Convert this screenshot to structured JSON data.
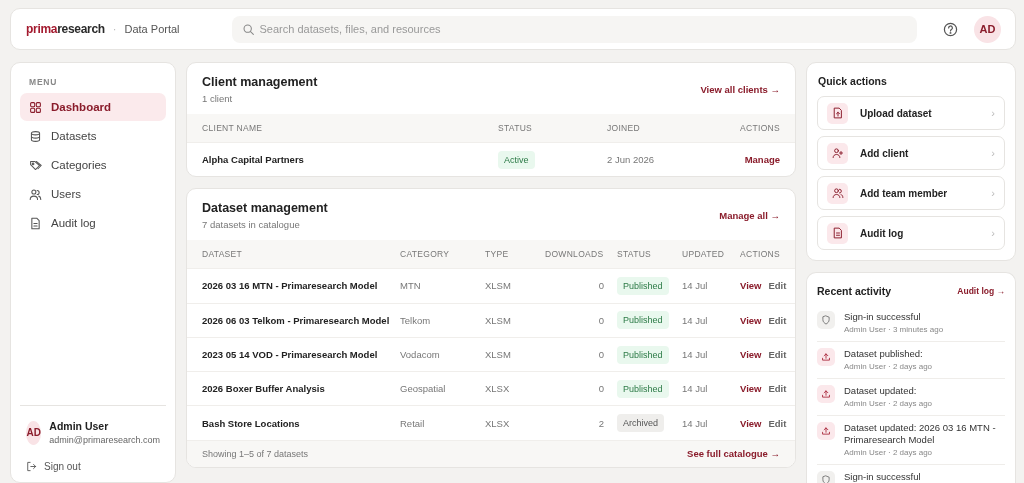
{
  "topbar": {
    "logo": {
      "accent": "prima",
      "rest": "research"
    },
    "separator": "·",
    "portal": "Data Portal",
    "search": {
      "placeholder": "Search datasets, files, and resources"
    },
    "avatar": "AD"
  },
  "sidebar": {
    "heading": "MENU",
    "items": [
      {
        "label": "Dashboard",
        "selected": true
      },
      {
        "label": "Datasets",
        "selected": false
      },
      {
        "label": "Categories",
        "selected": false
      },
      {
        "label": "Users",
        "selected": false
      },
      {
        "label": "Audit log",
        "selected": false
      }
    ],
    "user": {
      "initials": "AD",
      "name": "Admin User",
      "email": "admin@primaresearch.com"
    },
    "sign_out": "Sign out"
  },
  "client_management": {
    "title": "Client management",
    "subtitle": "1 client",
    "link": "View all clients →",
    "columns": [
      "CLIENT NAME",
      "STATUS",
      "JOINED",
      "ACTIONS"
    ],
    "rows": [
      {
        "name": "Alpha Capital Partners",
        "status": {
          "label": "Active",
          "kind": "positive"
        },
        "joined": "2 Jun 2026",
        "action": "Manage"
      }
    ]
  },
  "dataset_management": {
    "title": "Dataset management",
    "subtitle": "7 datasets in catalogue",
    "link": "Manage all →",
    "columns": [
      "DATASET",
      "CATEGORY",
      "TYPE",
      "DOWNLOADS",
      "STATUS",
      "UPDATED",
      "ACTIONS"
    ],
    "rows": [
      {
        "name": "2026 03 16 MTN - Primaresearch Model",
        "category": "MTN",
        "type": "XLSM",
        "downloads": "0",
        "status": {
          "label": "Published",
          "kind": "positive"
        },
        "updated": "14 Jul",
        "actions": [
          "View",
          "Edit"
        ]
      },
      {
        "name": "2026 06 03 Telkom - Primaresearch Model",
        "category": "Telkom",
        "type": "XLSM",
        "downloads": "0",
        "status": {
          "label": "Published",
          "kind": "positive"
        },
        "updated": "14 Jul",
        "actions": [
          "View",
          "Edit"
        ]
      },
      {
        "name": "2023 05 14 VOD - Primaresearch Model",
        "category": "Vodacom",
        "type": "XLSM",
        "downloads": "0",
        "status": {
          "label": "Published",
          "kind": "positive"
        },
        "updated": "14 Jul",
        "actions": [
          "View",
          "Edit"
        ]
      },
      {
        "name": "2026 Boxer Buffer Analysis",
        "category": "Geospatial",
        "type": "XLSX",
        "downloads": "0",
        "status": {
          "label": "Published",
          "kind": "positive"
        },
        "updated": "14 Jul",
        "actions": [
          "View",
          "Edit"
        ]
      },
      {
        "name": "Bash Store Locations",
        "category": "Retail",
        "type": "XLSX",
        "downloads": "2",
        "status": {
          "label": "Archived",
          "kind": "neutral"
        },
        "updated": "14 Jul",
        "actions": [
          "View",
          "Edit"
        ]
      }
    ],
    "footer": "Showing 1–5 of 7 datasets",
    "footer_link": "See full catalogue →"
  },
  "quick_actions": {
    "title": "Quick actions",
    "items": [
      {
        "label": "Upload dataset",
        "chevron": "›"
      },
      {
        "label": "Add client",
        "chevron": "›"
      },
      {
        "label": "Add team member",
        "chevron": "›"
      },
      {
        "label": "Audit log",
        "chevron": "›"
      }
    ]
  },
  "recent_activity": {
    "title": "Recent activity",
    "link": "Audit log →",
    "items": [
      {
        "kind": "security",
        "text": "Sign-in successful",
        "meta": "Admin User · 3 minutes ago"
      },
      {
        "kind": "upload",
        "text": "Dataset published:",
        "meta": "Admin User · 2 days ago"
      },
      {
        "kind": "upload",
        "text": "Dataset updated:",
        "meta": "Admin User · 2 days ago"
      },
      {
        "kind": "upload",
        "text": "Dataset updated: 2026 03 16 MTN - Primaresearch Model",
        "meta": "Admin User · 2 days ago"
      },
      {
        "kind": "security",
        "text": "Sign-in successful"
      }
    ]
  }
}
